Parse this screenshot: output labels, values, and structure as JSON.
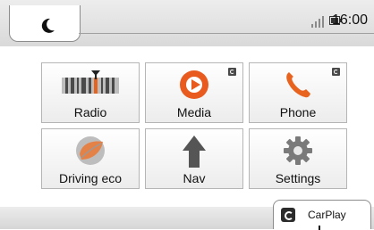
{
  "status_bar": {
    "night_mode_icon": "moon-icon",
    "signal_icon": "signal-icon",
    "battery_icon": "battery-icon",
    "time": "16:00"
  },
  "tiles": [
    {
      "id": "radio",
      "label": "Radio",
      "icon": "radio-icon",
      "badge": false
    },
    {
      "id": "media",
      "label": "Media",
      "icon": "media-play-icon",
      "badge": true
    },
    {
      "id": "phone",
      "label": "Phone",
      "icon": "phone-icon",
      "badge": true
    },
    {
      "id": "driving-eco",
      "label": "Driving eco",
      "icon": "leaf-icon",
      "badge": false
    },
    {
      "id": "nav",
      "label": "Nav",
      "icon": "navigation-arrow-icon",
      "badge": false
    },
    {
      "id": "settings",
      "label": "Settings",
      "icon": "gear-icon",
      "badge": false
    }
  ],
  "carplay": {
    "label": "CarPlay",
    "icon": "carplay-icon"
  },
  "colors": {
    "media_orange": "#e85a1e",
    "phone_orange": "#e8641e",
    "eco_orange": "#e87a3a",
    "nav_gray": "#555555",
    "settings_gray": "#7a7a7a"
  }
}
